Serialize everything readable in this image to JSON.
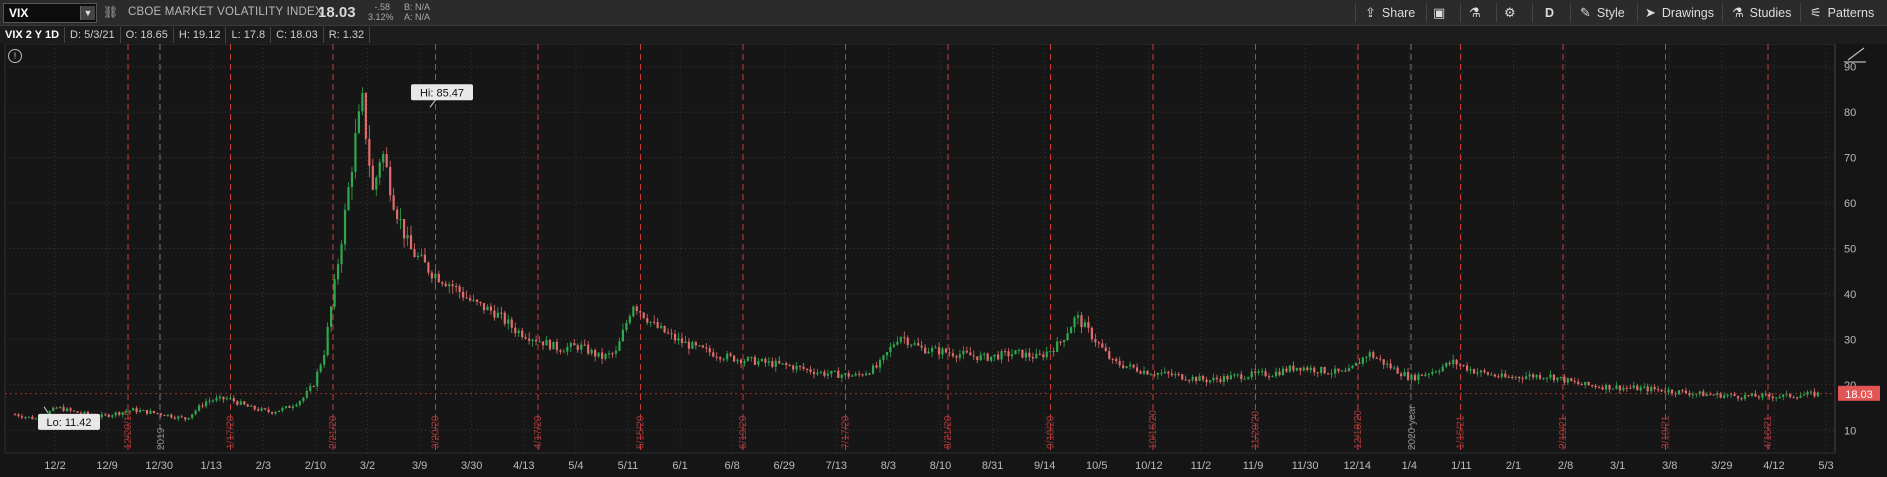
{
  "toolbar": {
    "symbol": "VIX",
    "index_name": "CBOE MARKET VOLATILITY INDEX",
    "last_price": "18.03",
    "change": "-.58",
    "change_pct": "3.12%",
    "bid": "B: N/A",
    "ask": "A: N/A",
    "share_label": "Share",
    "timeframe_label": "D",
    "style_label": "Style",
    "drawings_label": "Drawings",
    "studies_label": "Studies",
    "patterns_label": "Patterns"
  },
  "subbar": {
    "title": "VIX 2 Y 1D",
    "date": "D: 5/3/21",
    "open": "O: 18.65",
    "high": "H: 19.12",
    "low": "L: 17.8",
    "close": "C: 18.03",
    "range": "R: 1.32"
  },
  "colors": {
    "up": "#2fa84f",
    "down": "#e06c6c",
    "accent_red": "#c83a3a",
    "grid": "#3a3a3a"
  },
  "chart_data": {
    "type": "candlestick",
    "hi_label": "Hi: 85.47",
    "lo_label": "Lo: 11.42",
    "current_price_label": "18.03",
    "year_label": "2020 year",
    "last_value": 18.03,
    "y_ticks": [
      10,
      20,
      30,
      40,
      50,
      60,
      70,
      80,
      90
    ],
    "x_ticks": [
      "12/2",
      "12/9",
      "12/30",
      "1/13",
      "2/3",
      "2/10",
      "3/2",
      "3/9",
      "3/30",
      "4/13",
      "5/4",
      "5/11",
      "6/1",
      "6/8",
      "6/29",
      "7/13",
      "8/3",
      "8/10",
      "8/31",
      "9/14",
      "10/5",
      "10/12",
      "11/2",
      "11/9",
      "11/30",
      "12/14",
      "1/4",
      "1/11",
      "2/1",
      "2/8",
      "3/1",
      "3/8",
      "3/29",
      "4/12",
      "5/3"
    ],
    "event_labels": [
      "12/20/19",
      "1/17/20",
      "2/21/20",
      "3/20/20",
      "4/17/20",
      "5/15/20",
      "6/19/20",
      "7/17/20",
      "8/21/20",
      "9/18/20",
      "10/16/20",
      "11/20/20",
      "12/18/20",
      "1/15/21",
      "2/19/21",
      "3/19/21",
      "4/16/21"
    ],
    "year_marker_labels": [
      "2019",
      "2020 year"
    ],
    "anchors": [
      [
        0,
        13.5
      ],
      [
        10,
        12.5
      ],
      [
        20,
        15
      ],
      [
        28,
        14
      ],
      [
        40,
        13
      ],
      [
        55,
        14.5
      ],
      [
        70,
        13.5
      ],
      [
        80,
        12.5
      ],
      [
        90,
        16.5
      ],
      [
        100,
        17
      ],
      [
        110,
        15
      ],
      [
        120,
        14
      ],
      [
        128,
        15
      ],
      [
        135,
        17
      ],
      [
        140,
        20
      ],
      [
        145,
        27
      ],
      [
        150,
        42
      ],
      [
        155,
        58
      ],
      [
        160,
        75
      ],
      [
        163,
        82
      ],
      [
        168,
        62
      ],
      [
        172,
        72
      ],
      [
        178,
        60
      ],
      [
        185,
        50
      ],
      [
        195,
        45
      ],
      [
        205,
        42
      ],
      [
        215,
        38
      ],
      [
        225,
        36
      ],
      [
        235,
        32
      ],
      [
        245,
        30
      ],
      [
        255,
        28
      ],
      [
        265,
        28.5
      ],
      [
        275,
        26
      ],
      [
        282,
        27
      ],
      [
        290,
        38
      ],
      [
        300,
        33
      ],
      [
        310,
        30
      ],
      [
        320,
        28
      ],
      [
        335,
        26
      ],
      [
        350,
        25
      ],
      [
        365,
        24
      ],
      [
        380,
        22.5
      ],
      [
        395,
        22
      ],
      [
        405,
        24
      ],
      [
        415,
        31
      ],
      [
        425,
        28
      ],
      [
        440,
        27
      ],
      [
        455,
        26
      ],
      [
        470,
        27
      ],
      [
        480,
        26
      ],
      [
        490,
        29
      ],
      [
        498,
        35
      ],
      [
        505,
        31
      ],
      [
        515,
        25
      ],
      [
        530,
        23
      ],
      [
        545,
        22
      ],
      [
        560,
        21
      ],
      [
        575,
        22
      ],
      [
        590,
        22.5
      ],
      [
        602,
        24
      ],
      [
        615,
        23
      ],
      [
        625,
        22.5
      ],
      [
        635,
        27
      ],
      [
        645,
        24
      ],
      [
        655,
        21.5
      ],
      [
        665,
        23
      ],
      [
        675,
        25
      ],
      [
        685,
        23
      ],
      [
        700,
        21.5
      ],
      [
        710,
        22
      ],
      [
        720,
        22
      ],
      [
        735,
        20
      ],
      [
        750,
        19.5
      ],
      [
        770,
        19
      ],
      [
        790,
        18
      ],
      [
        810,
        17.5
      ],
      [
        830,
        17.5
      ],
      [
        846,
        18
      ]
    ],
    "hi_value": 85.47,
    "lo_value": 11.42,
    "ylim": [
      5,
      95
    ]
  }
}
